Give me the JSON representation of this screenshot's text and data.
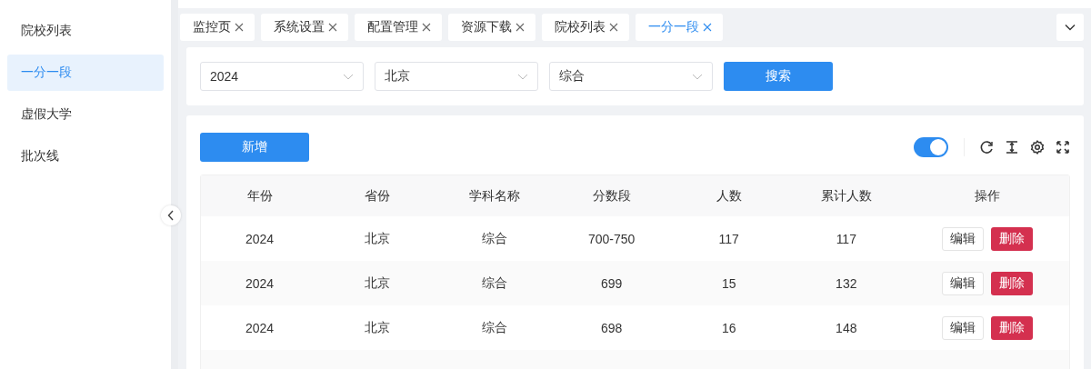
{
  "sidebar": {
    "items": [
      {
        "label": "院校列表",
        "selected": false
      },
      {
        "label": "一分一段",
        "selected": true
      },
      {
        "label": "虚假大学",
        "selected": false
      },
      {
        "label": "批次线",
        "selected": false
      }
    ]
  },
  "tabs": [
    {
      "label": "监控页",
      "selected": false
    },
    {
      "label": "系统设置",
      "selected": false
    },
    {
      "label": "配置管理",
      "selected": false
    },
    {
      "label": "资源下载",
      "selected": false
    },
    {
      "label": "院校列表",
      "selected": false
    },
    {
      "label": "一分一段",
      "selected": true
    }
  ],
  "filters": [
    {
      "value": "2024"
    },
    {
      "value": "北京"
    },
    {
      "value": "综合"
    }
  ],
  "search_button": "搜索",
  "add_button": "新增",
  "toggle": {
    "on": true
  },
  "table": {
    "columns": [
      "年份",
      "省份",
      "学科名称",
      "分数段",
      "人数",
      "累计人数",
      "操作"
    ],
    "rows": [
      {
        "cells": [
          "2024",
          "北京",
          "综合",
          "700-750",
          "117",
          "117"
        ],
        "edit": "编辑",
        "delete": "删除"
      },
      {
        "cells": [
          "2024",
          "北京",
          "综合",
          "699",
          "15",
          "132"
        ],
        "edit": "编辑",
        "delete": "删除"
      },
      {
        "cells": [
          "2024",
          "北京",
          "综合",
          "698",
          "16",
          "148"
        ],
        "edit": "编辑",
        "delete": "删除"
      }
    ]
  }
}
